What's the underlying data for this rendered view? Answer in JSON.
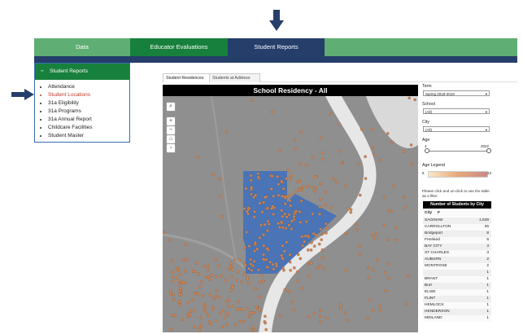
{
  "nav": {
    "tabs": [
      {
        "label": "Data"
      },
      {
        "label": "Educator Evaluations"
      },
      {
        "label": "Student Reports"
      },
      {
        "label": ""
      }
    ]
  },
  "menu": {
    "title": "Student Reports",
    "items": [
      {
        "label": "Attendance"
      },
      {
        "label": "Student Locations"
      },
      {
        "label": "31a Eligibility"
      },
      {
        "label": "31a Programs"
      },
      {
        "label": "31a Annual Report"
      },
      {
        "label": "Childcare Facilities"
      },
      {
        "label": "Student Master"
      }
    ]
  },
  "viz": {
    "tabs": [
      "Student Residences",
      "Students at Address"
    ],
    "title": "School Residency - All"
  },
  "filters": {
    "term_label": "Term",
    "term_value": "Spring 2018-2019",
    "school_label": "School",
    "school_value": "(All)",
    "city_label": "City",
    "city_value": "(All)",
    "age_label": "Age",
    "age_min": "4",
    "age_max": "2022",
    "legend_label": "Age Legend",
    "legend_min": "8",
    "legend_max": "23",
    "table_hint": "Please click and un-click to use the table as a filter."
  },
  "city_table": {
    "title": "Number of Students by City",
    "col_city": "City",
    "col_sort": "F",
    "rows": [
      {
        "city": "SAGINAW",
        "count": "1,639"
      },
      {
        "city": "CARROLLTON",
        "count": "36"
      },
      {
        "city": "Bridgeport",
        "count": "8"
      },
      {
        "city": "Freeland",
        "count": "6"
      },
      {
        "city": "BAY CITY",
        "count": "3"
      },
      {
        "city": "ST CHARLES",
        "count": "3"
      },
      {
        "city": "AUBURN",
        "count": "2"
      },
      {
        "city": "MONTROSE",
        "count": "2"
      },
      {
        "city": "",
        "count": "1"
      },
      {
        "city": "BRANT",
        "count": "1"
      },
      {
        "city": "Burt",
        "count": "1"
      },
      {
        "city": "ELSIE",
        "count": "1"
      },
      {
        "city": "FLINT",
        "count": "1"
      },
      {
        "city": "HEMLOCK",
        "count": "1"
      },
      {
        "city": "HENDERSON",
        "count": "1"
      },
      {
        "city": "MIDLAND",
        "count": "1"
      }
    ]
  },
  "map": {
    "land_color": "#8f8f8f",
    "water_color": "#e7e7e7",
    "district_color": "#4a74b5",
    "dot_color": "#d08858",
    "controls": [
      "search-icon",
      "zoom-in-icon",
      "zoom-out-icon",
      "home-icon",
      "expand-icon"
    ]
  }
}
